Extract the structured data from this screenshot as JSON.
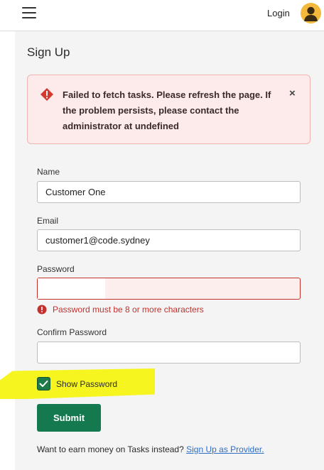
{
  "header": {
    "menu_icon": "hamburger-menu-icon",
    "login_label": "Login",
    "avatar_icon": "user-avatar-icon",
    "avatar_color": "#f4b93c"
  },
  "page": {
    "title": "Sign Up"
  },
  "alert": {
    "icon": "error-diamond-icon",
    "message": "Failed to fetch tasks. Please refresh the page. If the problem persists, please contact the administrator at undefined",
    "close_label": "×",
    "background": "#fcebea",
    "icon_color": "#d33a2f"
  },
  "form": {
    "name_label": "Name",
    "name_value": "Customer One",
    "email_label": "Email",
    "email_value": "customer1@code.sydney",
    "password_label": "Password",
    "password_value": "",
    "password_error": "Password must be 8 or more characters",
    "confirm_label": "Confirm Password",
    "confirm_value": "",
    "show_password_label": "Show Password",
    "show_password_checked": true,
    "submit_label": "Submit",
    "provider_prompt": "Want to earn money on Tasks instead?",
    "provider_link": "Sign Up as Provider.",
    "accent_color": "#14794e",
    "error_color": "#c4302b"
  }
}
